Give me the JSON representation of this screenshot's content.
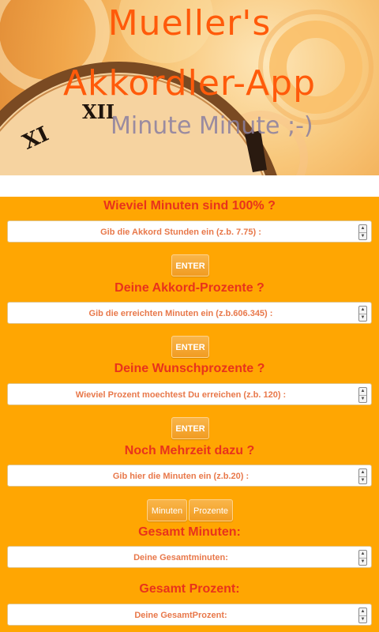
{
  "header": {
    "title_line1": "Mueller's",
    "title_line2": "Akkordler-App",
    "subtitle": "Minute  Minute ;-)",
    "clock_numerals": [
      "XI",
      "XII"
    ]
  },
  "sections": [
    {
      "title": "Wieviel Minuten sind 100% ?",
      "placeholder": "Gib die Akkord Stunden ein (z.b. 7.75) :",
      "button": "ENTER"
    },
    {
      "title": "Deine Akkord-Prozente ?",
      "placeholder": "Gib die erreichten Minuten ein (z.b.606.345) :",
      "button": "ENTER"
    },
    {
      "title": "Deine Wunschprozente ?",
      "placeholder": "Wieviel Prozent moechtest Du erreichen (z.b. 120) :",
      "button": "ENTER"
    },
    {
      "title": "Noch Mehrzeit dazu ?",
      "placeholder": "Gib hier die Minuten ein (z.b.20) :",
      "buttons": [
        "Minuten",
        "Prozente"
      ]
    }
  ],
  "results": [
    {
      "title": "Gesamt Minuten:",
      "placeholder": "Deine Gesamtminuten:"
    },
    {
      "title": "Gesamt Prozent:",
      "placeholder": "Deine GesamtProzent:"
    }
  ],
  "colors": {
    "background": "#ffa602",
    "title_text": "#e8331c",
    "placeholder_text": "#e8784a",
    "header_title": "#ff5a0a"
  },
  "icons": {
    "spinner": "spin-arrows-icon"
  }
}
